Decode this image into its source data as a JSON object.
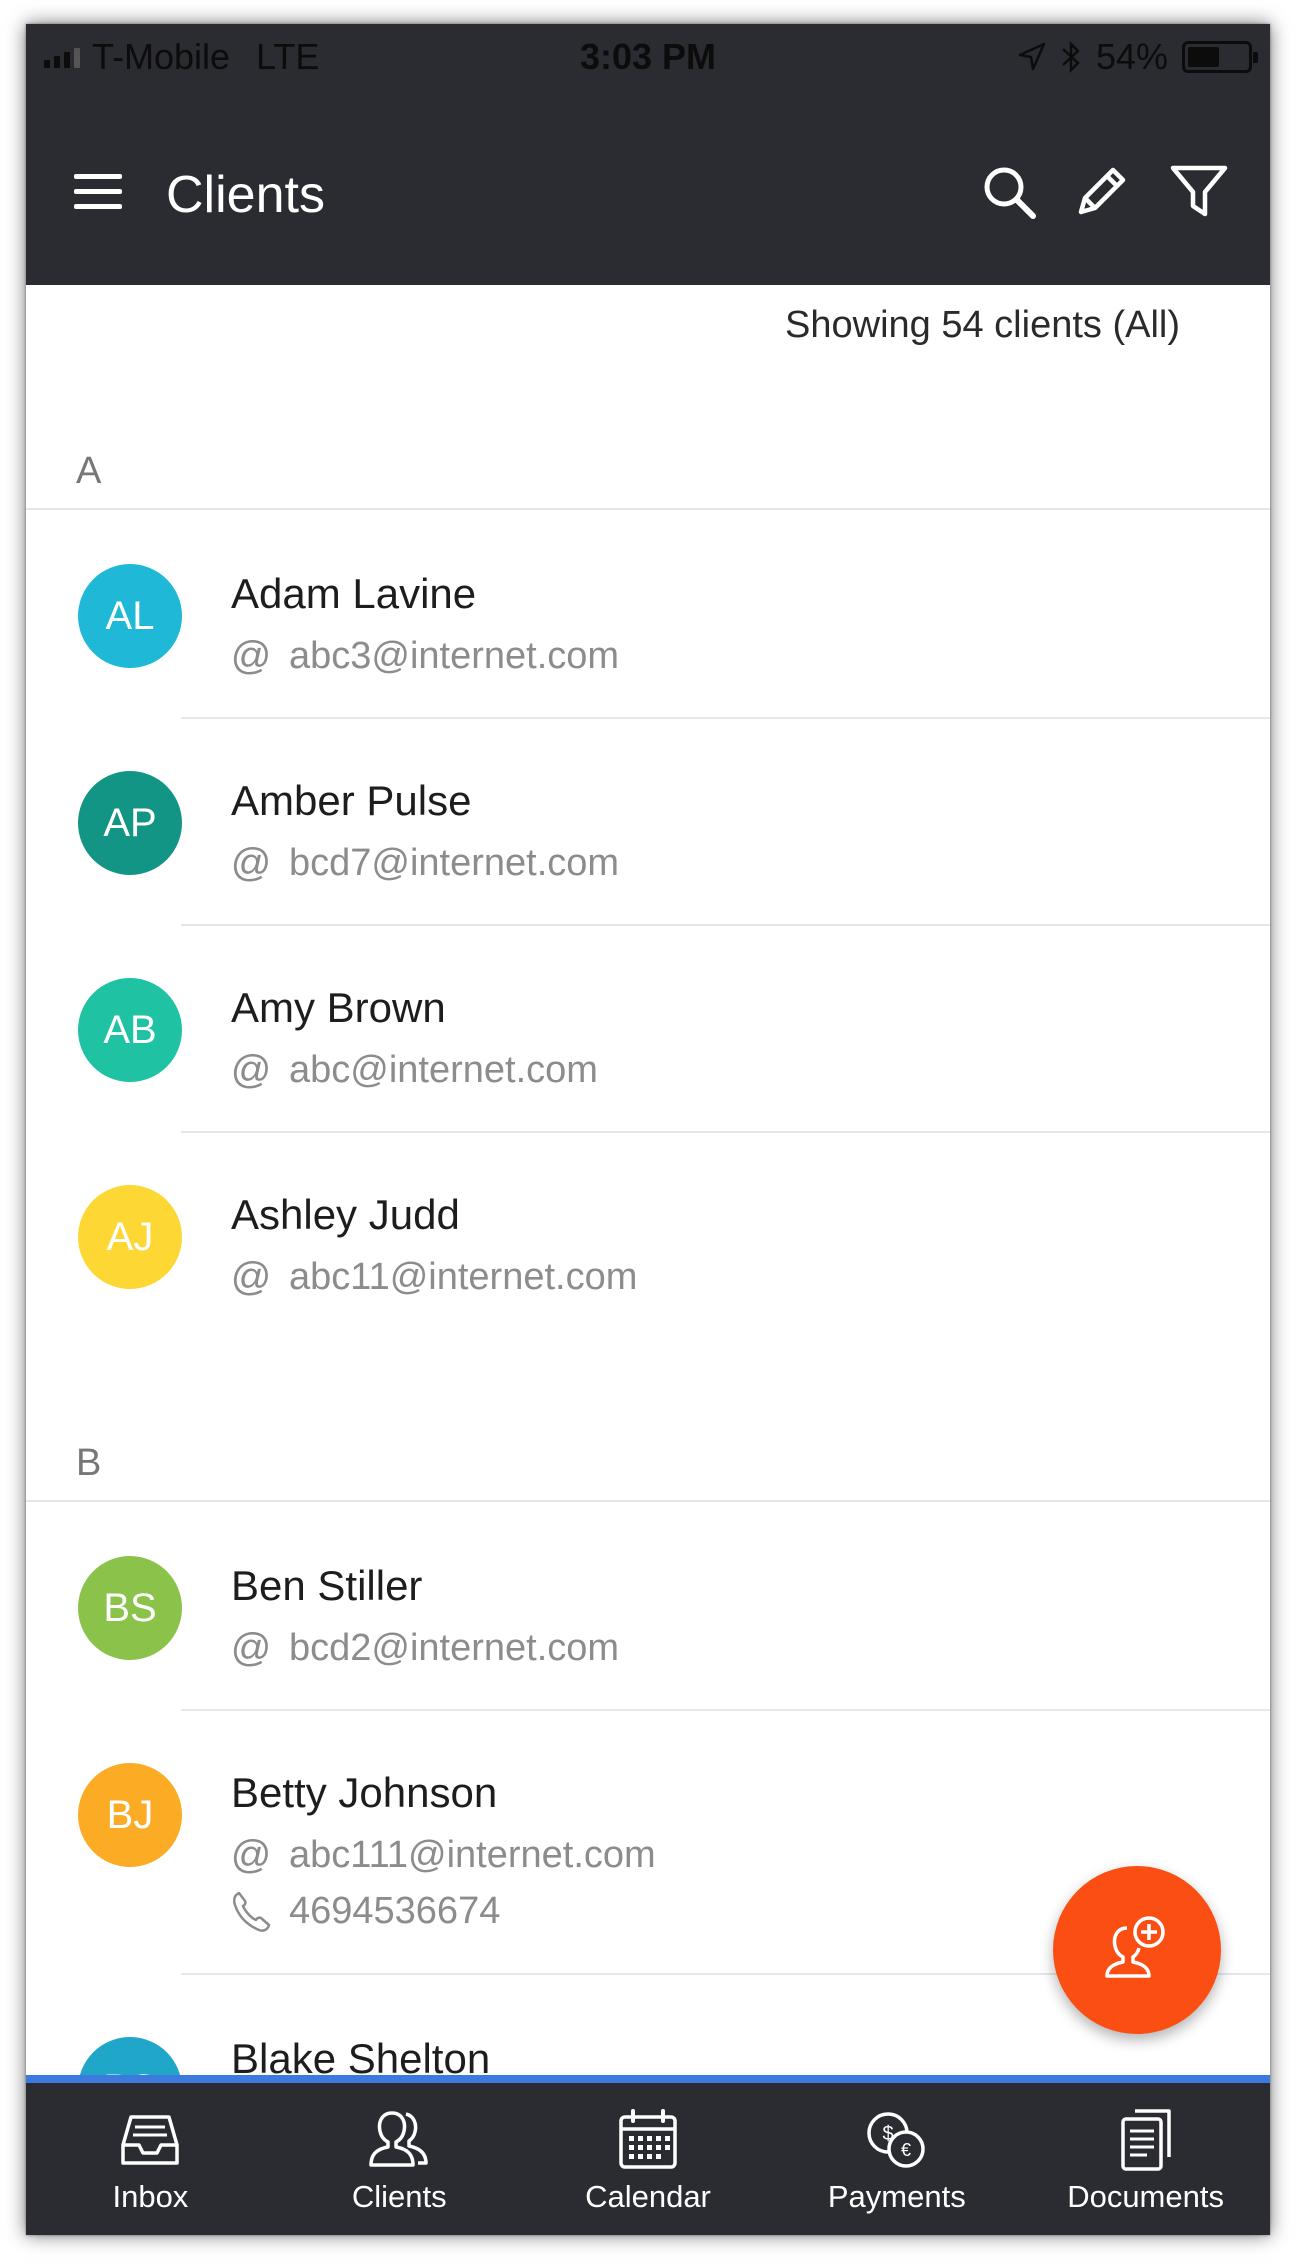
{
  "status_bar": {
    "carrier": "T-Mobile",
    "network": "LTE",
    "time": "3:03 PM",
    "battery": "54%",
    "battery_level": 0.54
  },
  "app_bar": {
    "title": "Clients",
    "icons": [
      "menu-icon",
      "search-icon",
      "pencil-icon",
      "filter-icon"
    ]
  },
  "summary": {
    "count_text": "Showing 54 clients (All)"
  },
  "sections": [
    {
      "letter": "A",
      "clients": [
        {
          "initials": "AL",
          "name": "Adam Lavine",
          "email": "abc3@internet.com",
          "color": "#1fb8d6"
        },
        {
          "initials": "AP",
          "name": "Amber Pulse",
          "email": "bcd7@internet.com",
          "color": "#139585"
        },
        {
          "initials": "AB",
          "name": "Amy Brown",
          "email": "abc@internet.com",
          "color": "#1fc2a3"
        },
        {
          "initials": "AJ",
          "name": "Ashley Judd",
          "email": "abc11@internet.com",
          "color": "#fdd835"
        }
      ]
    },
    {
      "letter": "B",
      "clients": [
        {
          "initials": "BS",
          "name": "Ben Stiller",
          "email": "bcd2@internet.com",
          "color": "#8bc34a"
        },
        {
          "initials": "BJ",
          "name": "Betty Johnson",
          "email": "abc111@internet.com",
          "phone": "4694536674",
          "color": "#fbab24"
        },
        {
          "initials": "BS",
          "name": "Blake Shelton",
          "color": "#1fa6c9"
        }
      ]
    }
  ],
  "fab": {
    "icon": "add-client-icon",
    "color": "#fb4e13"
  },
  "bottom_nav": {
    "items": [
      {
        "label": "Inbox",
        "icon": "inbox-icon"
      },
      {
        "label": "Clients",
        "icon": "clients-icon"
      },
      {
        "label": "Calendar",
        "icon": "calendar-icon"
      },
      {
        "label": "Payments",
        "icon": "payments-icon"
      },
      {
        "label": "Documents",
        "icon": "documents-icon"
      }
    ]
  },
  "colors": {
    "bar_background": "#2a2c31",
    "accent_line": "#3c7ade",
    "secondary_text": "#8c8c8c"
  }
}
